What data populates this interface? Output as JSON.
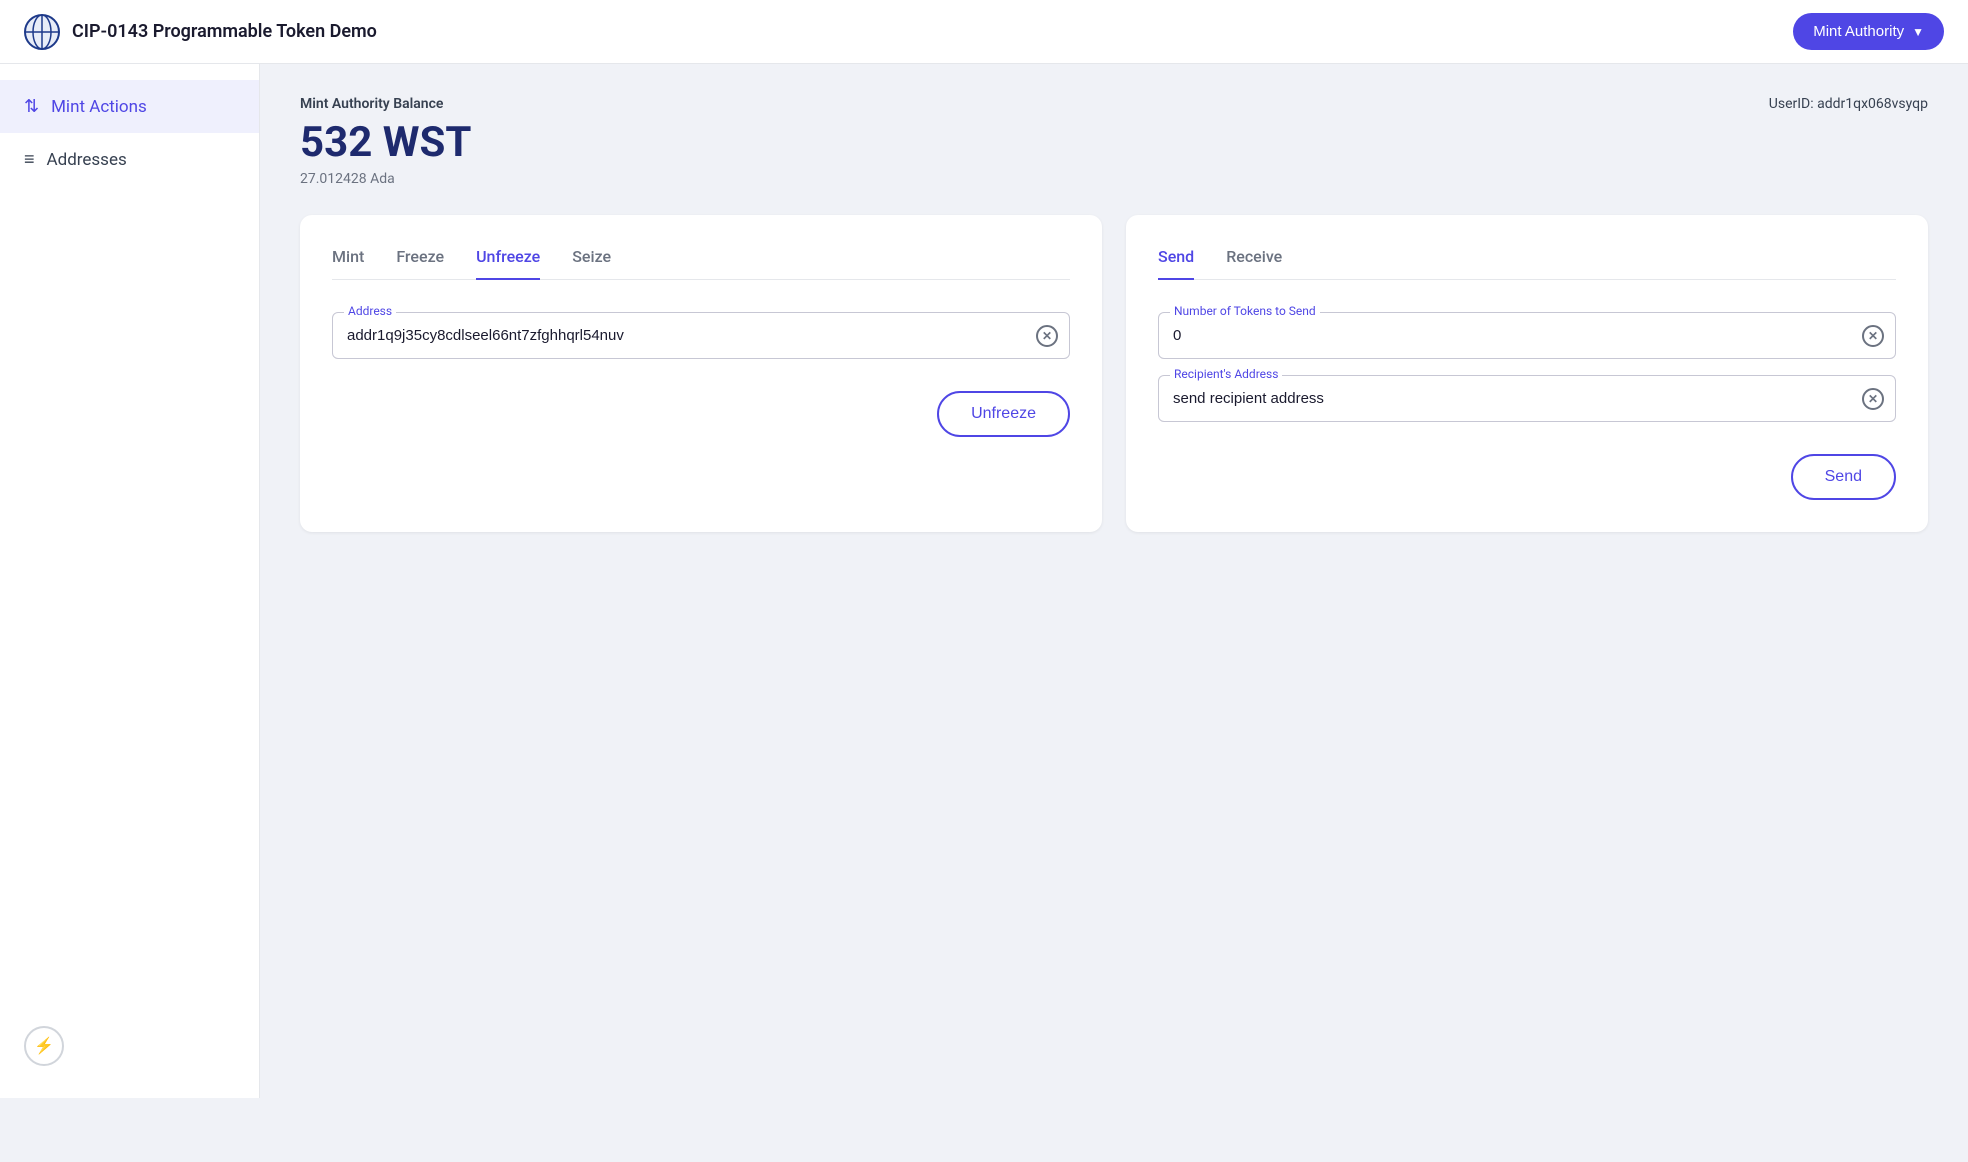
{
  "header": {
    "logo_alt": "CIP-0143 globe icon",
    "title": "CIP-0143 Programmable Token Demo",
    "mint_authority_label": "Mint Authority"
  },
  "sidebar": {
    "items": [
      {
        "id": "mint-actions",
        "label": "Mint Actions",
        "icon": "⇅",
        "active": true
      },
      {
        "id": "addresses",
        "label": "Addresses",
        "icon": "≡",
        "active": false
      }
    ],
    "power_icon": "⚡"
  },
  "main": {
    "balance_label": "Mint Authority Balance",
    "balance_amount": "532 WST",
    "balance_ada": "27.012428 Ada",
    "user_id": "UserID: addr1qx068vsyqp"
  },
  "left_card": {
    "tabs": [
      {
        "id": "mint",
        "label": "Mint",
        "active": false
      },
      {
        "id": "freeze",
        "label": "Freeze",
        "active": false
      },
      {
        "id": "unfreeze",
        "label": "Unfreeze",
        "active": true
      },
      {
        "id": "seize",
        "label": "Seize",
        "active": false
      }
    ],
    "address_label": "Address",
    "address_value": "addr1q9j35cy8cdlseel66nt7zfghhqrl54nuv",
    "address_placeholder": "Address",
    "action_btn_label": "Unfreeze"
  },
  "right_card": {
    "tabs": [
      {
        "id": "send",
        "label": "Send",
        "active": true
      },
      {
        "id": "receive",
        "label": "Receive",
        "active": false
      }
    ],
    "tokens_label": "Number of Tokens to Send",
    "tokens_value": "0",
    "tokens_placeholder": "Number of Tokens to Send",
    "recipient_label": "Recipient's Address",
    "recipient_value": "send recipient address",
    "recipient_placeholder": "Recipient's Address",
    "action_btn_label": "Send"
  }
}
